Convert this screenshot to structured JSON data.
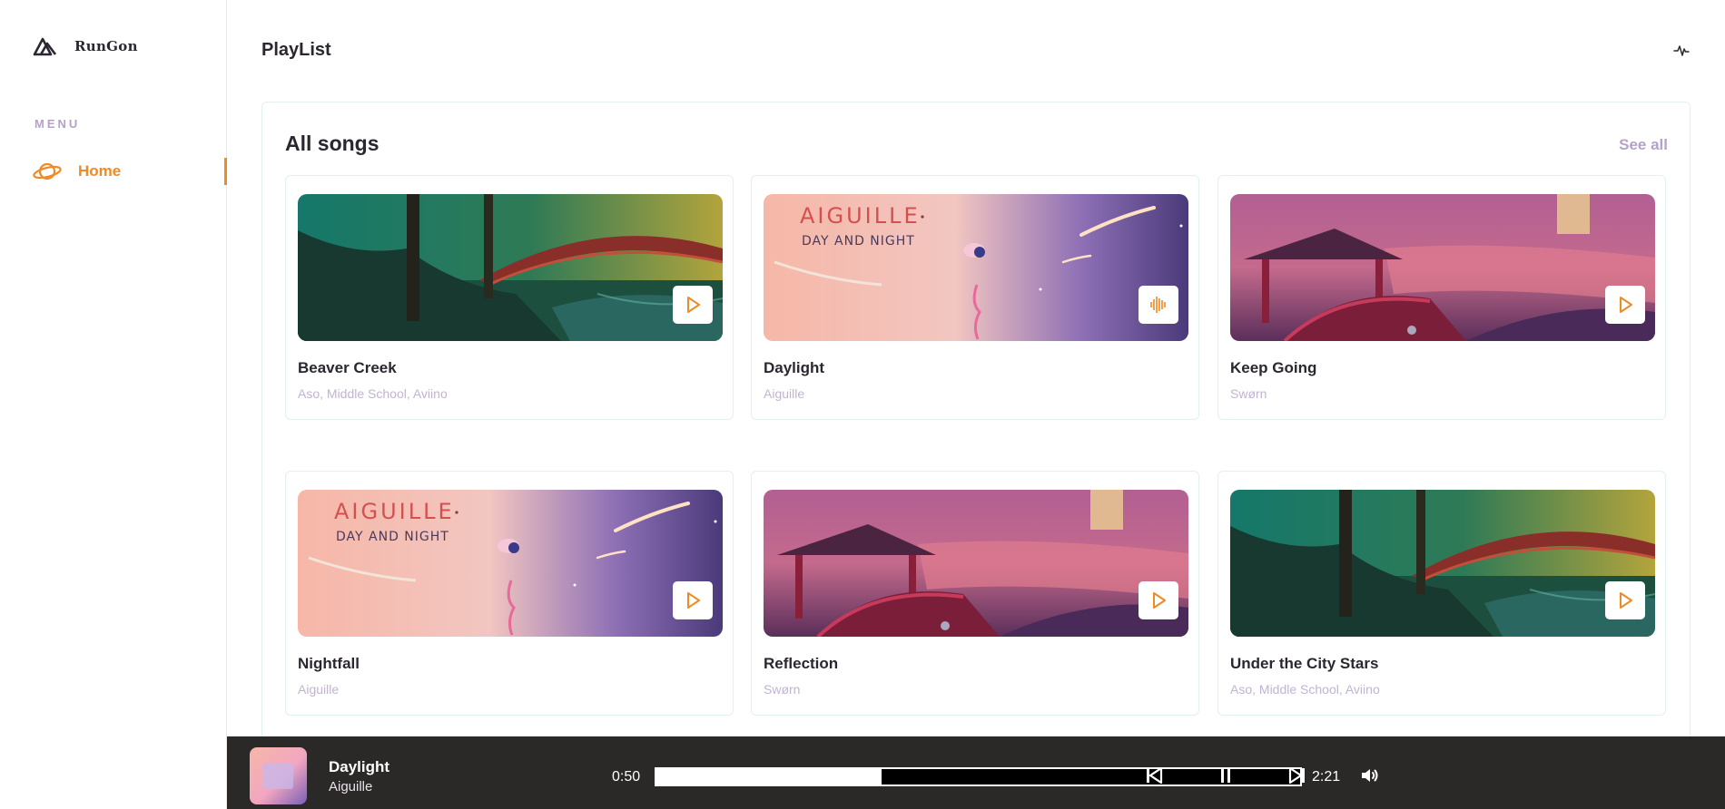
{
  "sidebar": {
    "brand": "RunGon",
    "menu_heading": "MENU",
    "items": [
      {
        "label": "Home",
        "icon": "planet-icon",
        "active": true
      }
    ]
  },
  "header": {
    "title": "PlayList",
    "icon": "pulse-icon"
  },
  "section": {
    "title": "All songs",
    "see_all": "See all"
  },
  "songs": [
    {
      "title": "Beaver Creek",
      "artist": "Aso, Middle School, Aviino",
      "art": "forest-bridge",
      "state": "play"
    },
    {
      "title": "Daylight",
      "artist": "Aiguille",
      "art": "aiguille-day-night",
      "state": "playing"
    },
    {
      "title": "Keep Going",
      "artist": "Swørn",
      "art": "pink-pagoda",
      "state": "play"
    },
    {
      "title": "Nightfall",
      "artist": "Aiguille",
      "art": "aiguille-day-night",
      "state": "play"
    },
    {
      "title": "Reflection",
      "artist": "Swørn",
      "art": "pink-pagoda",
      "state": "play"
    },
    {
      "title": "Under the City Stars",
      "artist": "Aso, Middle School, Aviino",
      "art": "forest-bridge",
      "state": "play"
    }
  ],
  "art_text": {
    "line1": "AIGUILLE",
    "line2": "DAY AND NIGHT"
  },
  "player": {
    "title": "Daylight",
    "artist": "Aiguille",
    "current_time": "0:50",
    "total_time": "2:21",
    "progress": 0.35,
    "controls": [
      "previous-icon",
      "pause-icon",
      "next-icon",
      "volume-icon"
    ]
  },
  "colors": {
    "accent": "#f08a24",
    "muted": "#b5a2c8",
    "player_bg": "#2b2828",
    "card_border": "#e1f1ef"
  }
}
